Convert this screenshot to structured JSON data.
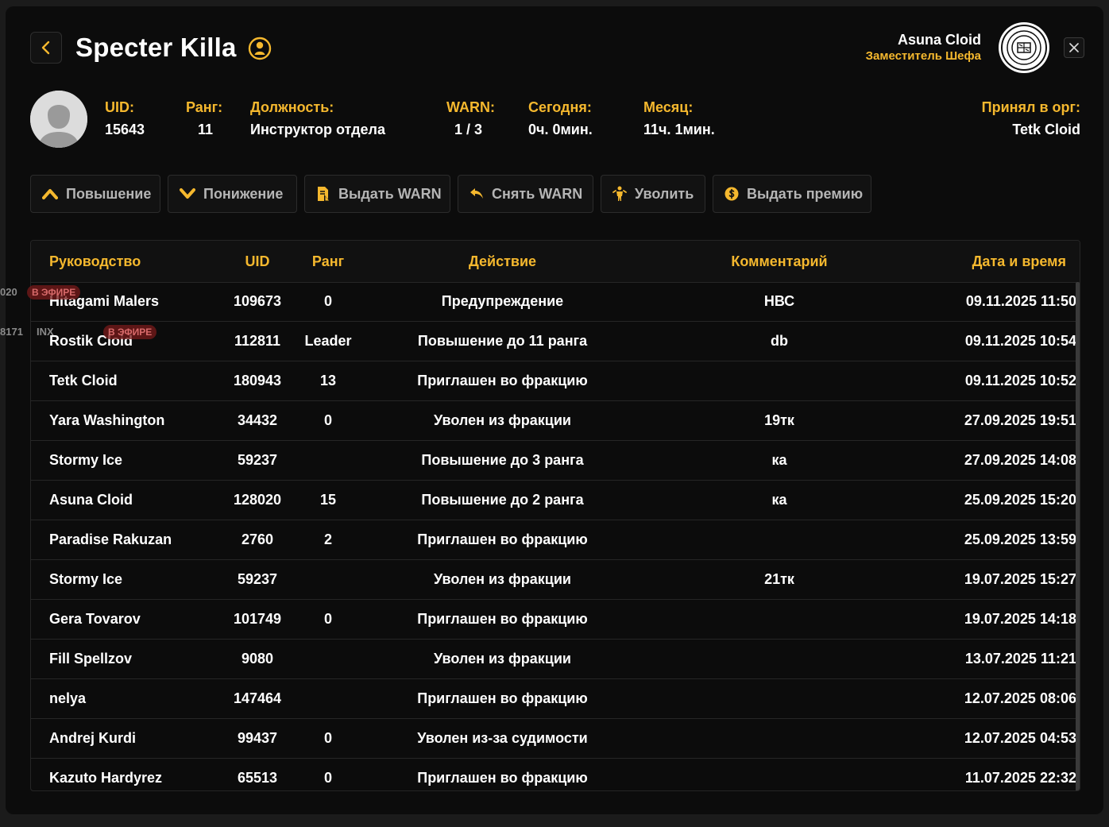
{
  "header": {
    "title": "Specter Killa",
    "current_user": {
      "name": "Asuna Cloid",
      "role": "Заместитель Шефа"
    }
  },
  "profile": {
    "fields": [
      {
        "label": "UID:",
        "value": "15643"
      },
      {
        "label": "Ранг:",
        "value": "11"
      },
      {
        "label": "Должность:",
        "value": "Инструктор отдела"
      },
      {
        "label": "WARN:",
        "value": "1 / 3"
      },
      {
        "label": "Сегодня:",
        "value": "0ч. 0мин."
      },
      {
        "label": "Месяц:",
        "value": "11ч. 1мин."
      },
      {
        "label": "Принял в орг:",
        "value": "Tetk Cloid"
      }
    ]
  },
  "actions": [
    {
      "label": "Повышение",
      "icon": "chevron-up-icon"
    },
    {
      "label": "Понижение",
      "icon": "chevron-down-icon"
    },
    {
      "label": "Выдать WARN",
      "icon": "warn-document-icon"
    },
    {
      "label": "Снять WARN",
      "icon": "undo-arrow-icon"
    },
    {
      "label": "Уволить",
      "icon": "dismiss-person-icon"
    },
    {
      "label": "Выдать премию",
      "icon": "coin-icon"
    }
  ],
  "table": {
    "columns": [
      "Руководство",
      "UID",
      "Ранг",
      "Действие",
      "Комментарий",
      "Дата и время"
    ],
    "rows": [
      {
        "name": "Hitagami Malers",
        "uid": "109673",
        "rank": "0",
        "action": "Предупреждение",
        "comment": "НВС",
        "date": "09.11.2025 11:50"
      },
      {
        "name": "Rostik Cloid",
        "uid": "112811",
        "rank": "Leader",
        "action": "Повышение до 11 ранга",
        "comment": "db",
        "date": "09.11.2025 10:54"
      },
      {
        "name": "Tetk Cloid",
        "uid": "180943",
        "rank": "13",
        "action": "Приглашен во фракцию",
        "comment": "",
        "date": "09.11.2025 10:52"
      },
      {
        "name": "Yara Washington",
        "uid": "34432",
        "rank": "0",
        "action": "Уволен из фракции",
        "comment": "19тк",
        "date": "27.09.2025 19:51"
      },
      {
        "name": "Stormy Ice",
        "uid": "59237",
        "rank": "",
        "action": "Повышение до 3 ранга",
        "comment": "ка",
        "date": "27.09.2025 14:08"
      },
      {
        "name": "Asuna Cloid",
        "uid": "128020",
        "rank": "15",
        "action": "Повышение до 2 ранга",
        "comment": "ка",
        "date": "25.09.2025 15:20"
      },
      {
        "name": "Paradise Rakuzan",
        "uid": "2760",
        "rank": "2",
        "action": "Приглашен во фракцию",
        "comment": "",
        "date": "25.09.2025 13:59"
      },
      {
        "name": "Stormy Ice",
        "uid": "59237",
        "rank": "",
        "action": "Уволен из фракции",
        "comment": "21тк",
        "date": "19.07.2025 15:27"
      },
      {
        "name": "Gera Tovarov",
        "uid": "101749",
        "rank": "0",
        "action": "Приглашен во фракцию",
        "comment": "",
        "date": "19.07.2025 14:18"
      },
      {
        "name": "Fill Spellzov",
        "uid": "9080",
        "rank": "",
        "action": "Уволен из фракции",
        "comment": "",
        "date": "13.07.2025 11:21"
      },
      {
        "name": "nelya",
        "uid": "147464",
        "rank": "",
        "action": "Приглашен во фракцию",
        "comment": "",
        "date": "12.07.2025 08:06"
      },
      {
        "name": "Andrej Kurdi",
        "uid": "99437",
        "rank": "0",
        "action": "Уволен из-за судимости",
        "comment": "",
        "date": "12.07.2025 04:53"
      },
      {
        "name": "Kazuto Hardyrez",
        "uid": "65513",
        "rank": "0",
        "action": "Приглашен во фракцию",
        "comment": "",
        "date": "11.07.2025 22:32"
      }
    ]
  },
  "overlay": {
    "items": [
      {
        "id_text": "020",
        "badge": "В ЭФИРЕ"
      },
      {
        "id_text": "8171",
        "tag": "INX",
        "badge": "В ЭФИРЕ"
      }
    ]
  },
  "colors": {
    "accent": "#f5b82e",
    "background": "#0c0c0c",
    "border": "#262626"
  }
}
